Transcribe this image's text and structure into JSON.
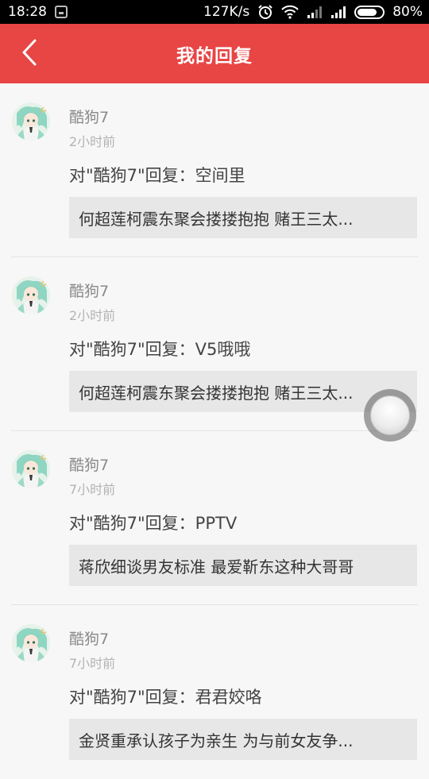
{
  "status_bar": {
    "time": "18:28",
    "network_speed": "127K/s",
    "battery_percent": "80%",
    "battery_level": 0.8,
    "icons": [
      "sim-card-icon",
      "alarm-icon",
      "wifi-icon",
      "signal-icon",
      "signal-icon",
      "battery-icon"
    ]
  },
  "app_bar": {
    "back_icon": "chevron-left-icon",
    "title": "我的回复",
    "color": "#e84545"
  },
  "replies": [
    {
      "user": "酷狗7",
      "time_ago": "2小时前",
      "reply": "对\"酷狗7\"回复：空间里",
      "quote": "何超莲柯震东聚会搂搂抱抱 赌王三太..."
    },
    {
      "user": "酷狗7",
      "time_ago": "2小时前",
      "reply": "对\"酷狗7\"回复：V5哦哦",
      "quote": "何超莲柯震东聚会搂搂抱抱 赌王三太..."
    },
    {
      "user": "酷狗7",
      "time_ago": "7小时前",
      "reply": "对\"酷狗7\"回复：PPTV",
      "quote": "蒋欣细谈男友标准 最爱靳东这种大哥哥"
    },
    {
      "user": "酷狗7",
      "time_ago": "7小时前",
      "reply": "对\"酷狗7\"回复：君君姣咯",
      "quote": "金贤重承认孩子为亲生 为与前女友争..."
    }
  ]
}
